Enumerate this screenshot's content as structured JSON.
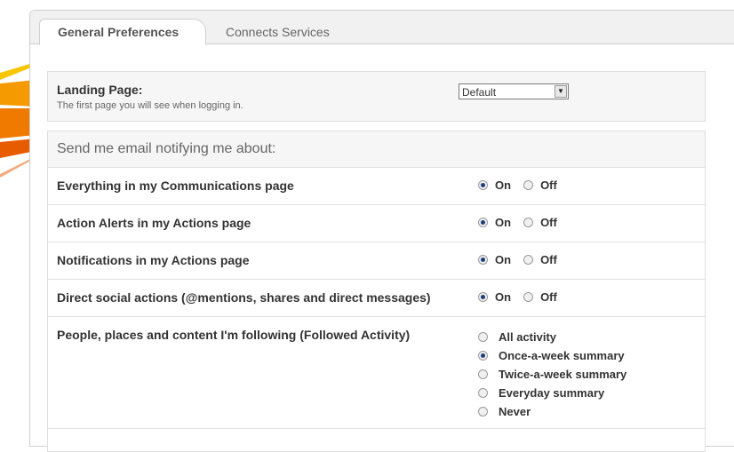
{
  "tabs": [
    {
      "label": "General Preferences"
    },
    {
      "label": "Connects Services"
    }
  ],
  "landing": {
    "label": "Landing Page:",
    "description": "The first page you will see when logging in.",
    "selected": "Default"
  },
  "email": {
    "heading": "Send me email notifying me about:",
    "rows": [
      {
        "label": "Everything in my Communications page",
        "on": "On",
        "off": "Off",
        "value": "On"
      },
      {
        "label": "Action Alerts in my Actions page",
        "on": "On",
        "off": "Off",
        "value": "On"
      },
      {
        "label": "Notifications in my Actions page",
        "on": "On",
        "off": "Off",
        "value": "On"
      },
      {
        "label": "Direct social actions (@mentions, shares and direct messages)",
        "on": "On",
        "off": "Off",
        "value": "On"
      }
    ],
    "followed": {
      "label": "People, places and content I'm following (Followed Activity)",
      "options": [
        "All activity",
        "Once-a-week summary",
        "Twice-a-week summary",
        "Everyday summary",
        "Never"
      ],
      "selected": "Once-a-week summary"
    }
  }
}
